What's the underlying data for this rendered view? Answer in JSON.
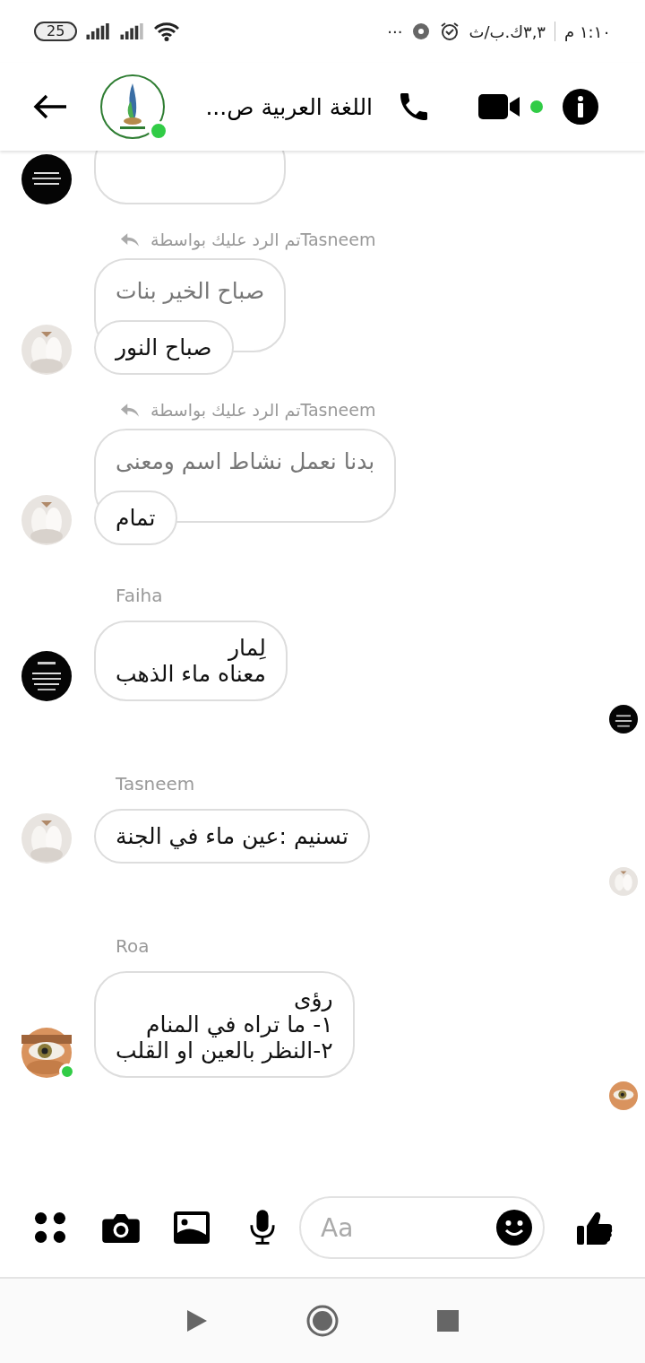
{
  "status_bar": {
    "battery": "25",
    "more": "···",
    "data_speed": "٣,٣ك.ب/ث",
    "time": "١:١٠ م"
  },
  "header": {
    "title": "اللغة العربية ص...",
    "online": true,
    "video_online": true
  },
  "messages": [
    {
      "kind": "partial"
    },
    {
      "kind": "reply",
      "reply_label": "Tasneemتم الرد عليك بواسطة",
      "quoted": "صباح الخير بنات",
      "text": "صباح النور",
      "online": false,
      "seen": false
    },
    {
      "kind": "reply",
      "reply_label": "Tasneemتم الرد عليك بواسطة",
      "quoted": "بدنا نعمل نشاط اسم ومعنى",
      "text": "تمام",
      "online": false,
      "seen": false
    },
    {
      "kind": "named",
      "sender": "Faiha",
      "text": "لِمار\nمعناه ماء الذهب",
      "online": false,
      "seen": true
    },
    {
      "kind": "named",
      "sender": "Tasneem",
      "text": "تسنيم :عين ماء في الجنة",
      "online": false,
      "seen": true
    },
    {
      "kind": "named",
      "sender": "Roa",
      "text": "رؤى\n١- ما تراه في المنام\n٢-النظر بالعين او القلب",
      "online": true,
      "seen": true
    }
  ],
  "composer": {
    "placeholder": "Aa"
  }
}
